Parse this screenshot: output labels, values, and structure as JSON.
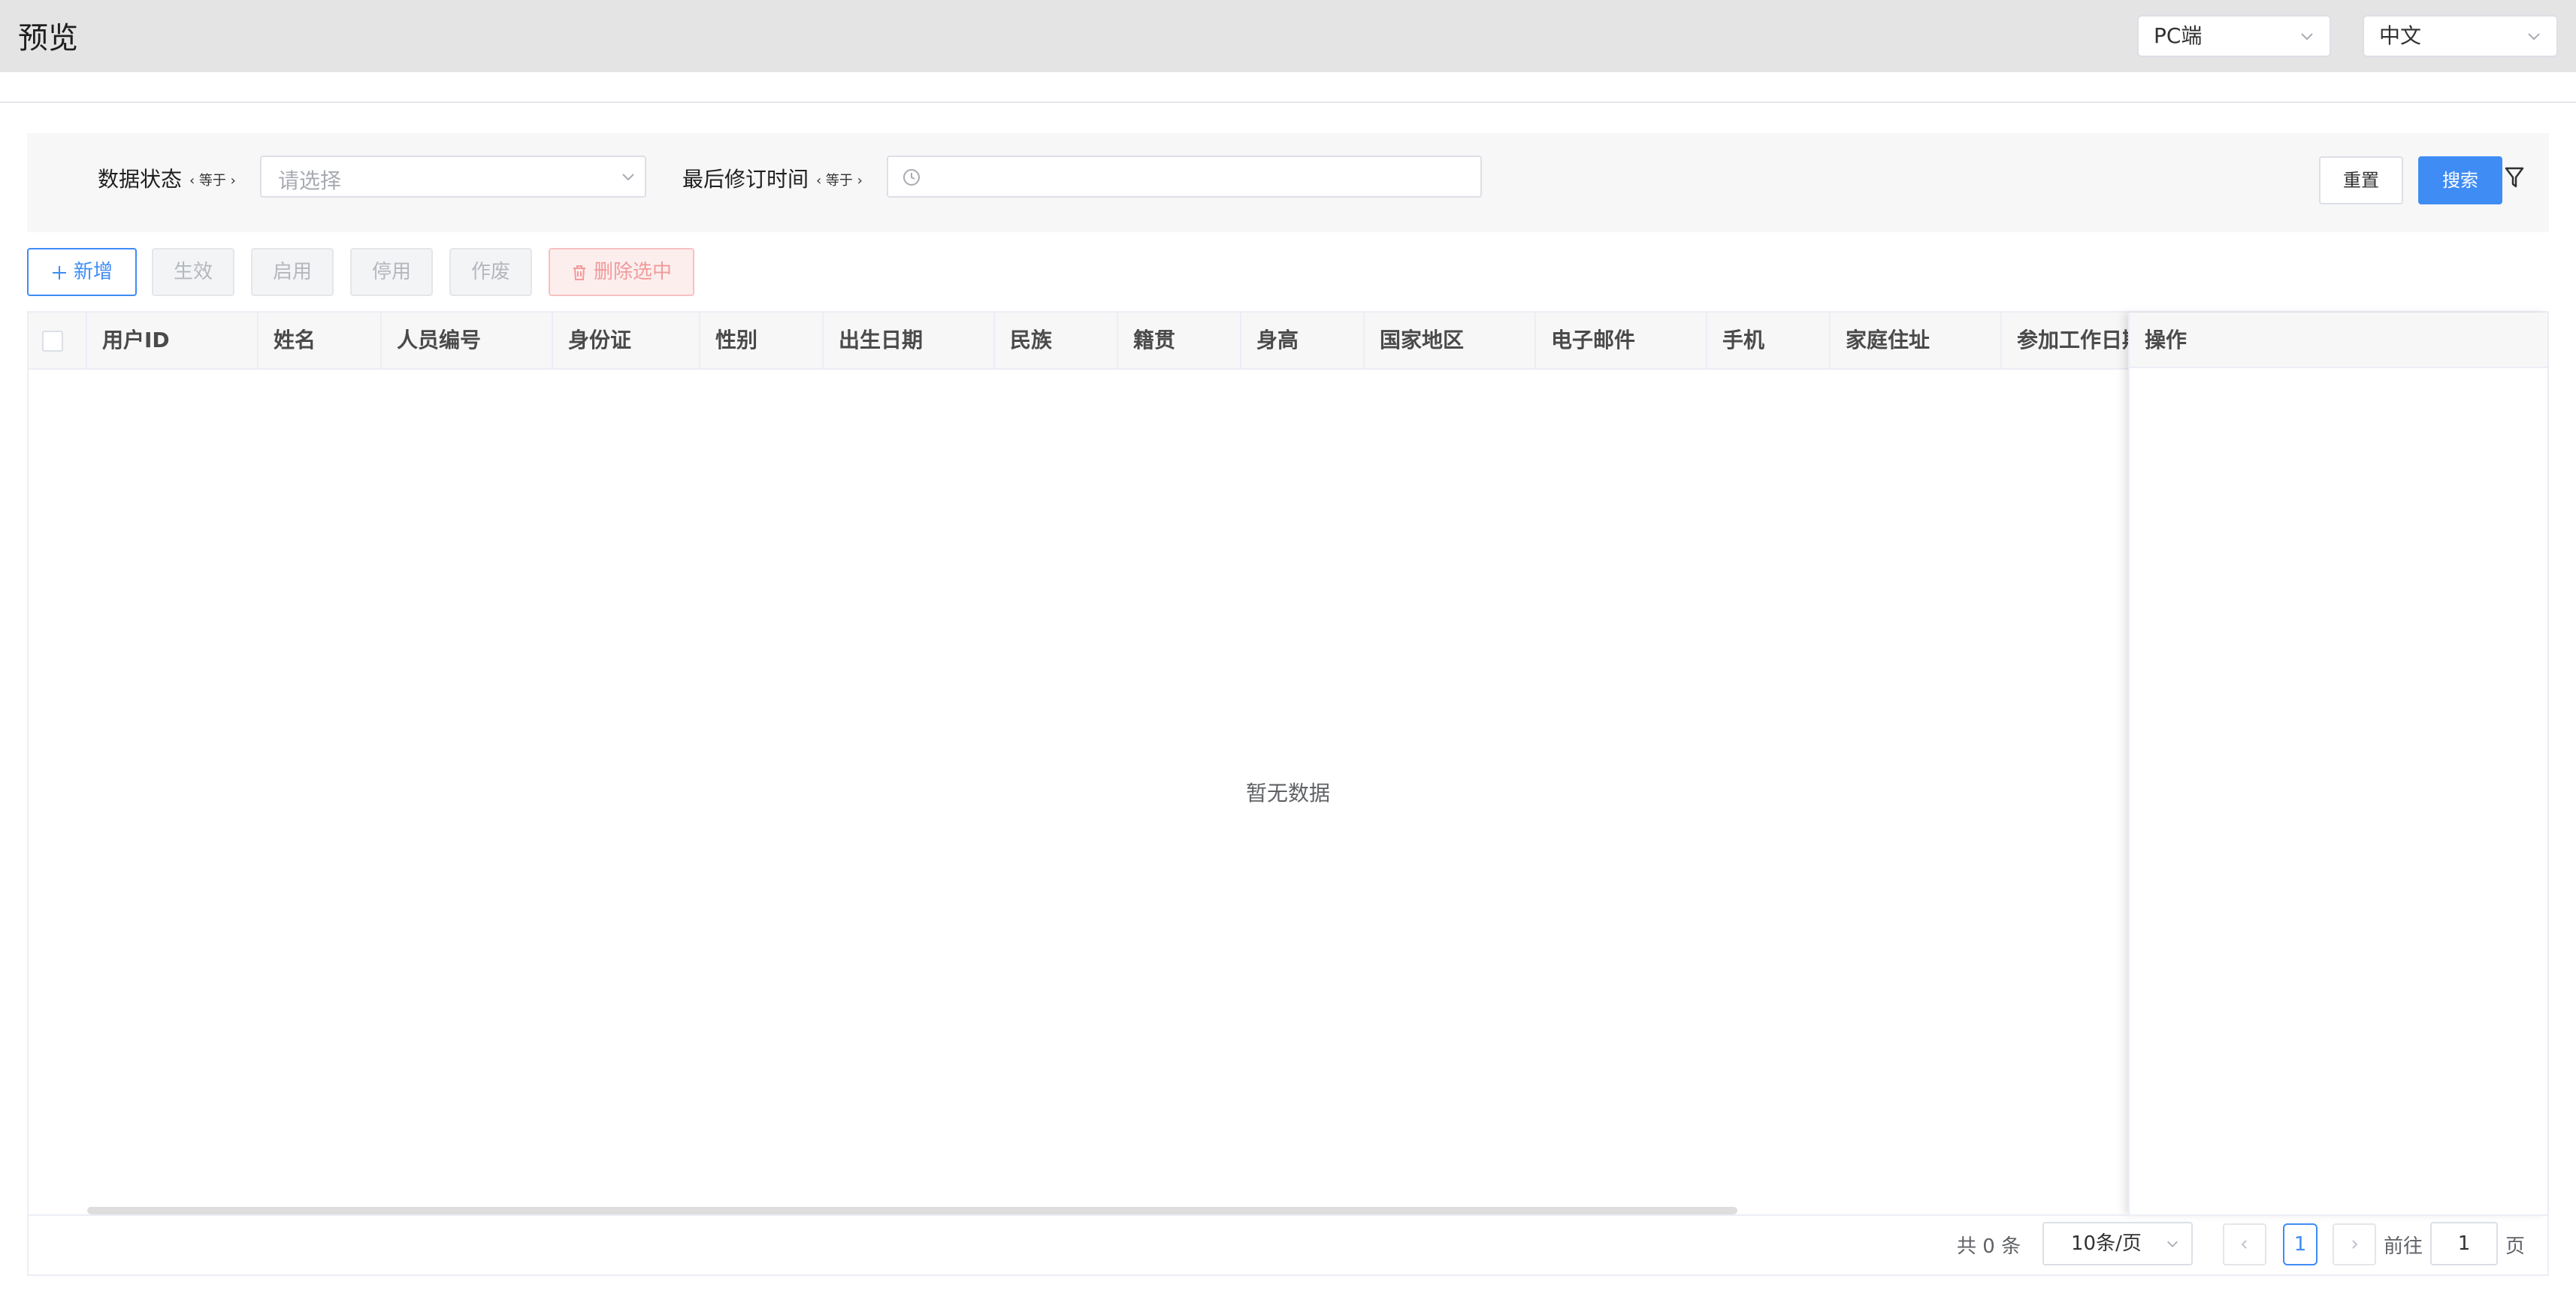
{
  "header": {
    "title": "预览",
    "platform_select": "PC端",
    "language_select": "中文"
  },
  "filters": {
    "status": {
      "label": "数据状态",
      "operator": "‹ 等于 ›",
      "placeholder": "请选择"
    },
    "modified": {
      "label": "最后修订时间",
      "operator": "‹ 等于 ›",
      "value": ""
    },
    "reset_label": "重置",
    "search_label": "搜索"
  },
  "toolbar": {
    "add_label": "新增",
    "activate_label": "生效",
    "enable_label": "启用",
    "disable_label": "停用",
    "void_label": "作废",
    "delete_selected_label": "删除选中"
  },
  "table": {
    "columns": [
      "用户ID",
      "姓名",
      "人员编号",
      "身份证",
      "性别",
      "出生日期",
      "民族",
      "籍贯",
      "身高",
      "国家地区",
      "电子邮件",
      "手机",
      "家庭住址",
      "参加工作日期"
    ],
    "action_column": "操作",
    "empty_text": "暂无数据"
  },
  "pagination": {
    "total_text": "共 0 条",
    "page_size": "10条/页",
    "current_page": "1",
    "goto_label": "前往",
    "goto_value": "1",
    "page_suffix": "页"
  },
  "icons": {
    "add": "plus-icon",
    "delete": "trash-icon",
    "date": "clock-icon",
    "filter": "filter-icon",
    "dropdown": "chevron-down-icon"
  },
  "colors": {
    "primary": "#3f8cf5",
    "header_bg": "#e4e4e4",
    "danger_text": "#f19a9a"
  }
}
